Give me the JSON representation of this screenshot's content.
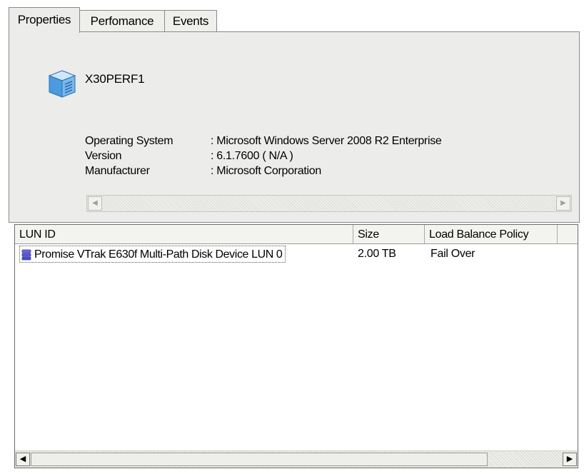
{
  "tabs": [
    {
      "label": "Properties",
      "active": true
    },
    {
      "label": "Perfomance",
      "active": false
    },
    {
      "label": "Events",
      "active": false
    }
  ],
  "server": {
    "name": "X30PERF1",
    "icon": "server-cube-icon"
  },
  "properties": [
    {
      "label": "Operating System",
      "value": ": Microsoft Windows Server 2008 R2 Enterprise"
    },
    {
      "label": "Version",
      "value": ": 6.1.7600 ( N/A )"
    },
    {
      "label": "Manufacturer",
      "value": ": Microsoft Corporation"
    }
  ],
  "lun_table": {
    "columns": [
      "LUN ID",
      "Size",
      "Load Balance Policy"
    ],
    "rows": [
      {
        "lun_id": "Promise VTrak E630f  Multi-Path Disk Device LUN 0",
        "size": "2.00  TB",
        "policy": "Fail Over",
        "icon": "disk-stack-icon"
      }
    ]
  },
  "colors": {
    "panel_bg": "#ececea",
    "icon_blue": "#3f8fd6",
    "disk_purple": "#5b5bd6"
  }
}
